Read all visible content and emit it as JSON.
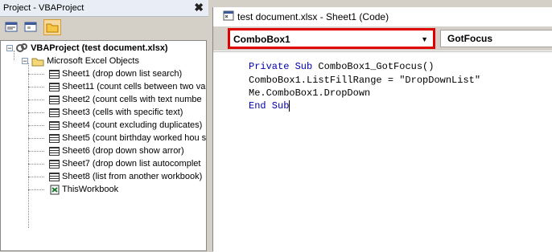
{
  "project": {
    "title": "Project - VBAProject",
    "close_glyph": "✖",
    "root": {
      "label": "VBAProject (test document.xlsx)",
      "expander": "−"
    },
    "folder": {
      "label": "Microsoft Excel Objects",
      "expander": "−"
    },
    "sheets": [
      "Sheet1 (drop down list search)",
      "Sheet11 (count cells between two va",
      "Sheet2 (count cells with text numbe",
      "Sheet3 (cells with specific text)",
      "Sheet4 (count excluding duplicates)",
      "Sheet5 (count birthday worked hou s",
      "Sheet6 (drop down show arror)",
      "Sheet7 (drop down list autocomplet",
      "Sheet8 (list from another workbook)"
    ],
    "workbook": "ThisWorkbook"
  },
  "code_window": {
    "title": "test document.xlsx - Sheet1 (Code)",
    "object_dropdown": "ComboBox1",
    "dropdown_arrow": "▼",
    "procedure_dropdown": "GotFocus",
    "code": {
      "line1_kw": "Private Sub",
      "line1_rest": " ComboBox1_GotFocus()",
      "line2": "ComboBox1.ListFillRange = \"DropDownList\"",
      "line3": "Me.ComboBox1.DropDown",
      "line4_kw": "End Sub"
    }
  },
  "colors": {
    "highlight_border": "#e00000",
    "keyword": "#0000b0"
  }
}
